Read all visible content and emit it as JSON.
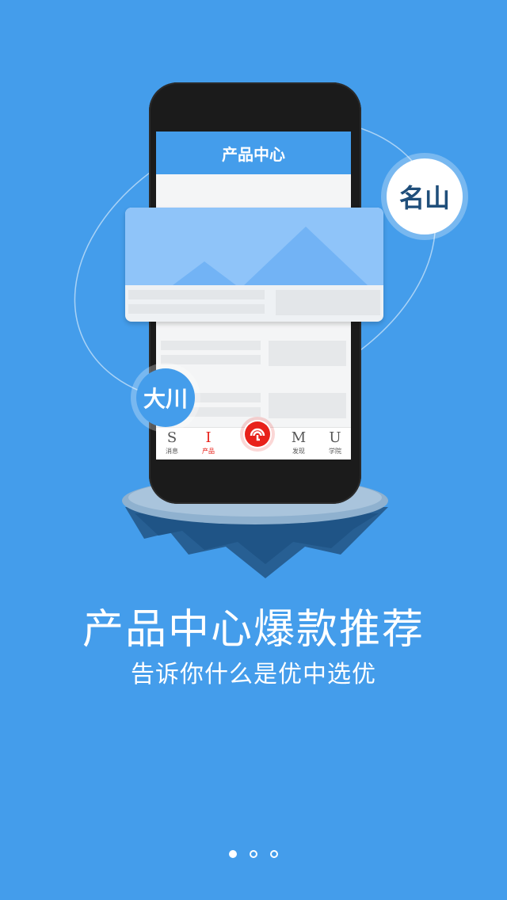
{
  "phone": {
    "screen_title": "产品中心",
    "tabs": [
      {
        "glyph": "S",
        "label": "消息",
        "active": false
      },
      {
        "glyph": "I",
        "label": "产品",
        "active": true
      },
      {
        "glyph": "M",
        "label": "发现",
        "active": false
      },
      {
        "glyph": "U",
        "label": "学院",
        "active": false
      }
    ],
    "center_tab_icon": "umbrella-signal-icon"
  },
  "bubbles": {
    "mountain": "名山",
    "river": "大川"
  },
  "headline": "产品中心爆款推荐",
  "subline": "告诉你什么是优中选优",
  "pager": {
    "count": 3,
    "active_index": 0
  },
  "colors": {
    "background": "#449deb",
    "accent_red": "#e8211a",
    "bubble_text": "#1f4e7a"
  }
}
